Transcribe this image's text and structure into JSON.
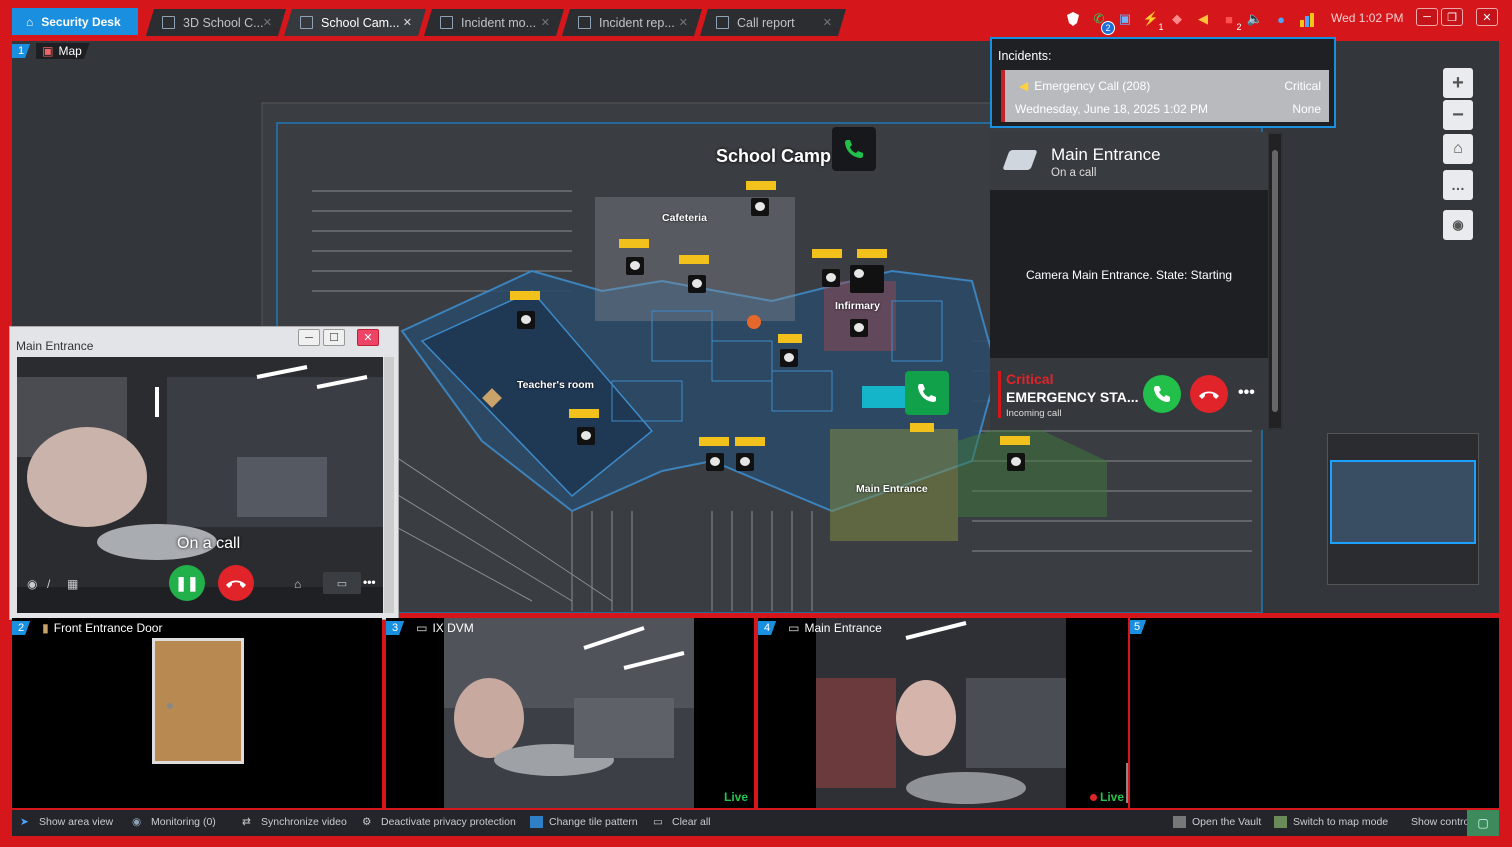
{
  "tabs": {
    "home": "Security Desk",
    "items": [
      {
        "label": "3D School C..."
      },
      {
        "label": "School Cam..."
      },
      {
        "label": "Incident mo..."
      },
      {
        "label": "Incident rep..."
      },
      {
        "label": "Call report"
      }
    ]
  },
  "tray": {
    "calls_badge": "2",
    "alarm_badge": "1",
    "notif_badge": "2",
    "clock": "Wed 1:02 PM"
  },
  "map_tile": {
    "number": "1",
    "label": "Map",
    "title": "School Camp",
    "areas": {
      "cafeteria": "Cafeteria",
      "infirmary": "Infirmary",
      "teachers_room": "Teacher's room",
      "main_entrance": "Main Entrance"
    }
  },
  "incidents": {
    "title": "Incidents:",
    "item": {
      "name": "Emergency Call (208)",
      "priority": "Critical",
      "date": "Wednesday, June 18, 2025 1:02 PM",
      "assignee": "None"
    }
  },
  "call_panel": {
    "location": "Main Entrance",
    "status": "On a call",
    "camera_state": "Camera Main Entrance. State: Starting",
    "priority": "Critical",
    "caller": "EMERGENCY STA...",
    "call_type": "Incoming call"
  },
  "float_window": {
    "title": "Main Entrance",
    "overlay": "On a call"
  },
  "bottom_tiles": [
    {
      "number": "2",
      "label": "Front Entrance Door",
      "live": ""
    },
    {
      "number": "3",
      "label": "IX DVM",
      "live": "Live"
    },
    {
      "number": "4",
      "label": "Main Entrance",
      "live": "Live"
    },
    {
      "number": "5",
      "label": "",
      "live": ""
    }
  ],
  "footer": {
    "show_area_view": "Show area view",
    "monitoring": "Monitoring (0)",
    "sync_video": "Synchronize video",
    "deactivate_privacy": "Deactivate privacy protection",
    "change_tile": "Change tile pattern",
    "clear_all": "Clear all",
    "open_vault": "Open the Vault",
    "switch_map": "Switch to map mode",
    "show_controls": "Show controls"
  },
  "colors": {
    "frame_red": "#d5161b",
    "accent_blue": "#1a8fe0",
    "answer_green": "#22c04a",
    "hangup_red": "#e0242a",
    "live_green": "#29c24b"
  }
}
